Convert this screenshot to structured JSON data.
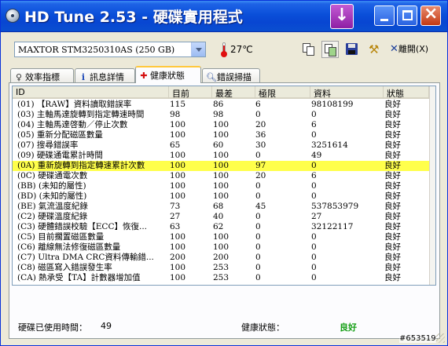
{
  "window": {
    "title": "HD Tune 2.53 - 硬碟實用程式"
  },
  "toolbar": {
    "drive": "MAXTOR STM3250310AS (250 GB)",
    "temperature": "27℃",
    "exit_label": "離開(X)",
    "exit_symbol": "✕"
  },
  "tabs": [
    {
      "label": "效率指標",
      "icon": "lightbulb-icon"
    },
    {
      "label": "訊息詳情",
      "icon": "info-icon"
    },
    {
      "label": "健康狀態",
      "icon": "health-cross-icon",
      "active": true
    },
    {
      "label": "錯誤掃描",
      "icon": "search-icon"
    }
  ],
  "table": {
    "columns": [
      "ID",
      "目前",
      "最差",
      "極限",
      "資料",
      "狀態"
    ],
    "rows": [
      [
        "(01) 【RAW】資料讀取錯誤率",
        "115",
        "86",
        "6",
        "98108199",
        "良好"
      ],
      [
        "(03) 主軸馬達旋轉到指定轉速時間",
        "98",
        "98",
        "0",
        "0",
        "良好"
      ],
      [
        "(04) 主軸馬達啓動／停止次數",
        "100",
        "100",
        "20",
        "6",
        "良好"
      ],
      [
        "(05) 重新分配磁區數量",
        "100",
        "100",
        "36",
        "0",
        "良好"
      ],
      [
        "(07) 搜尋錯誤率",
        "65",
        "60",
        "30",
        "3251614",
        "良好"
      ],
      [
        "(09) 硬碟通電累計時間",
        "100",
        "100",
        "0",
        "49",
        "良好"
      ],
      [
        "(0A) 重新旋轉到指定轉速累計次數",
        "100",
        "100",
        "97",
        "0",
        "良好"
      ],
      [
        "(0C) 硬碟通電次數",
        "100",
        "100",
        "20",
        "6",
        "良好"
      ],
      [
        "(BB) (未知的屬性)",
        "100",
        "100",
        "0",
        "0",
        "良好"
      ],
      [
        "(BD) (未知的屬性)",
        "100",
        "100",
        "0",
        "0",
        "良好"
      ],
      [
        "(BE) 氣流溫度紀錄",
        "73",
        "68",
        "45",
        "537853979",
        "良好"
      ],
      [
        "(C2) 硬碟溫度紀錄",
        "27",
        "40",
        "0",
        "27",
        "良好"
      ],
      [
        "(C3) 硬體錯誤校驗【ECC】恢復...",
        "63",
        "62",
        "0",
        "32122117",
        "良好"
      ],
      [
        "(C5) 目前擱置磁區數量",
        "100",
        "100",
        "0",
        "0",
        "良好"
      ],
      [
        "(C6) 離線無法修復磁區數量",
        "100",
        "100",
        "0",
        "0",
        "良好"
      ],
      [
        "(C7) Ultra DMA CRC資料傳輸錯...",
        "200",
        "200",
        "0",
        "0",
        "良好"
      ],
      [
        "(C8) 磁區寫入錯誤發生率",
        "100",
        "253",
        "0",
        "0",
        "良好"
      ],
      [
        "(CA) 熱承受【TA】計數器增加值",
        "100",
        "253",
        "0",
        "0",
        "良好"
      ]
    ],
    "highlight_row_index": 6,
    "highlight_color": "#ffff4b"
  },
  "footer": {
    "hours_label": "硬碟已使用時間：",
    "hours_value": "49",
    "health_label": "健康狀態：",
    "health_value": "良好",
    "health_color": "#18a018"
  },
  "watermark": "#653519"
}
